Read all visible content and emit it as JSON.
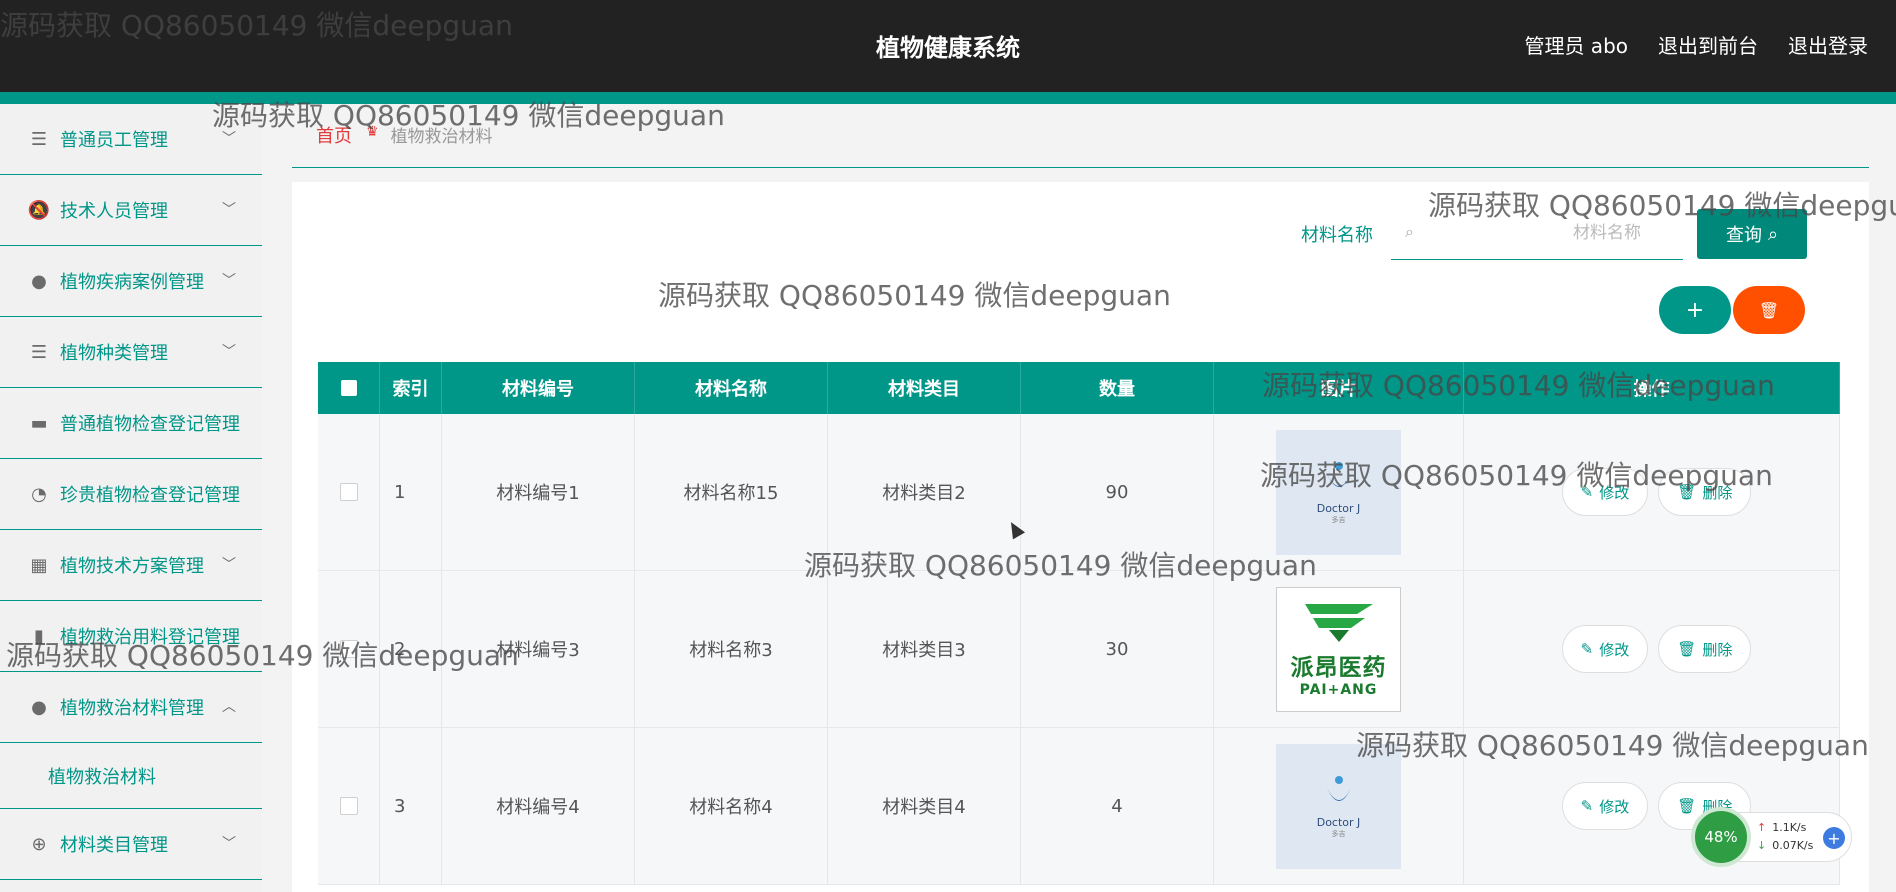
{
  "header": {
    "title": "植物健康系统",
    "nav": [
      "管理员 abo",
      "退出到前台",
      "退出登录"
    ]
  },
  "sidebar": {
    "items": [
      {
        "label": "普通员工管理",
        "icon": "list-icon",
        "chevron": "﹀"
      },
      {
        "label": "技术人员管理",
        "icon": "bell-icon",
        "chevron": "﹀"
      },
      {
        "label": "植物疾病案例管理",
        "icon": "user-icon",
        "chevron": "﹀"
      },
      {
        "label": "植物种类管理",
        "icon": "list-icon",
        "chevron": "﹀"
      },
      {
        "label": "普通植物检查登记管理",
        "icon": "briefcase-icon",
        "chevron": ""
      },
      {
        "label": "珍贵植物检查登记管理",
        "icon": "gauge-icon",
        "chevron": ""
      },
      {
        "label": "植物技术方案管理",
        "icon": "grid-icon",
        "chevron": "﹀"
      },
      {
        "label": "植物救治用料登记管理",
        "icon": "doc-icon",
        "chevron": ""
      },
      {
        "label": "植物救治材料管理",
        "icon": "bulb-icon",
        "chevron": "︿"
      }
    ],
    "sub": "植物救治材料",
    "last": {
      "label": "材料类目管理",
      "icon": "crosshair-icon",
      "chevron": "﹀"
    }
  },
  "breadcrumb": {
    "home": "首页",
    "current": "植物救治材料"
  },
  "search": {
    "label": "材料名称",
    "placeholder": "材料名称",
    "button": "查询"
  },
  "buttons": {
    "add": "+",
    "del": "🗑"
  },
  "table": {
    "headers": [
      "索引",
      "材料编号",
      "材料名称",
      "材料类目",
      "数量",
      "图片",
      "操作"
    ],
    "rows": [
      {
        "index": "1",
        "code": "材料编号1",
        "name": "材料名称15",
        "category": "材料类目2",
        "qty": "90",
        "img": "dj"
      },
      {
        "index": "2",
        "code": "材料编号3",
        "name": "材料名称3",
        "category": "材料类目3",
        "qty": "30",
        "img": "pa"
      },
      {
        "index": "3",
        "code": "材料编号4",
        "name": "材料名称4",
        "category": "材料类目4",
        "qty": "4",
        "img": "dj"
      }
    ],
    "edit": "修改",
    "delete": "删除",
    "dj_logo": "Doctor J",
    "dj_sub": "多吉",
    "pa_cn": "派昂医药",
    "pa_en": "PAI+ANG"
  },
  "watermark": "源码获取 QQ86050149 微信deepguan",
  "network": {
    "percent": "48%",
    "up": "1.1K/s",
    "down": "0.07K/s",
    "plus": "+"
  },
  "colors": {
    "accent": "#009688",
    "danger": "#ff5000",
    "header": "#222222"
  }
}
